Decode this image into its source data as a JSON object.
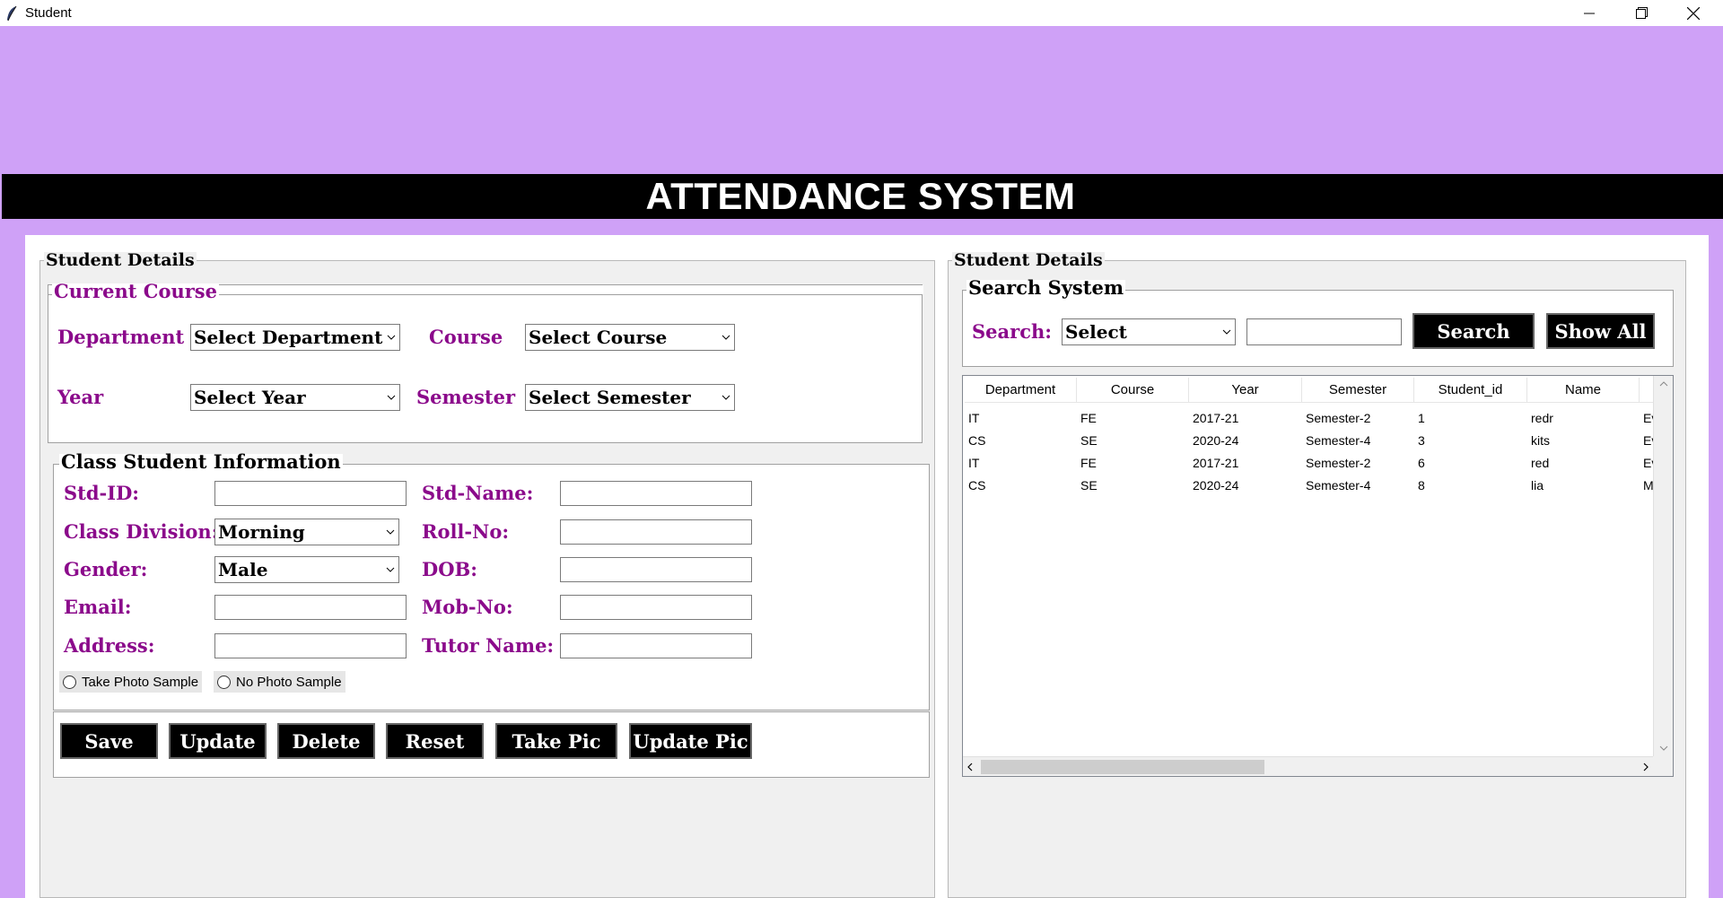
{
  "window": {
    "title": "Student"
  },
  "banner": {
    "title": "ATTENDANCE SYSTEM"
  },
  "left": {
    "frame_title": "Student Details",
    "current_course": {
      "title": "Current Course",
      "department_label": "Department",
      "department_value": "Select Department",
      "course_label": "Course",
      "course_value": "Select Course",
      "year_label": "Year",
      "year_value": "Select Year",
      "semester_label": "Semester",
      "semester_value": "Select Semester"
    },
    "class_info": {
      "title": "Class Student Information",
      "std_id_label": "Std-ID:",
      "std_name_label": "Std-Name:",
      "division_label": "Class Division:",
      "division_value": "Morning",
      "roll_label": "Roll-No:",
      "gender_label": "Gender:",
      "gender_value": "Male",
      "dob_label": "DOB:",
      "email_label": "Email:",
      "mob_label": "Mob-No:",
      "address_label": "Address:",
      "tutor_label": "Tutor Name:",
      "radio_take": "Take Photo Sample",
      "radio_no": "No Photo Sample"
    },
    "buttons": {
      "save": "Save",
      "update": "Update",
      "delete": "Delete",
      "reset": "Reset",
      "take_pic": "Take Pic",
      "update_pic": "Update Pic"
    }
  },
  "right": {
    "frame_title": "Student Details",
    "search_system": {
      "title": "Search System",
      "search_label": "Search:",
      "search_by_value": "Select",
      "search_button": "Search",
      "show_all_button": "Show All"
    },
    "table": {
      "columns": [
        "Department",
        "Course",
        "Year",
        "Semester",
        "Student_id",
        "Name"
      ],
      "rows": [
        [
          "IT",
          "FE",
          "2017-21",
          "Semester-2",
          "1",
          "redr",
          "Ev"
        ],
        [
          "CS",
          "SE",
          "2020-24",
          "Semester-4",
          "3",
          "kits",
          "Ev"
        ],
        [
          "IT",
          "FE",
          "2017-21",
          "Semester-2",
          "6",
          "red",
          "Ev"
        ],
        [
          "CS",
          "SE",
          "2020-24",
          "Semester-4",
          "8",
          "lia",
          "M"
        ]
      ]
    }
  },
  "icons": {
    "app": "feather-icon",
    "minimize": "minimize-icon",
    "maximize": "restore-icon",
    "close": "close-icon",
    "dropdown": "chevron-down-icon"
  },
  "colors": {
    "background": "#cfa1f7",
    "banner": "#000000",
    "label": "#8b0a8b",
    "button": "#000000"
  }
}
